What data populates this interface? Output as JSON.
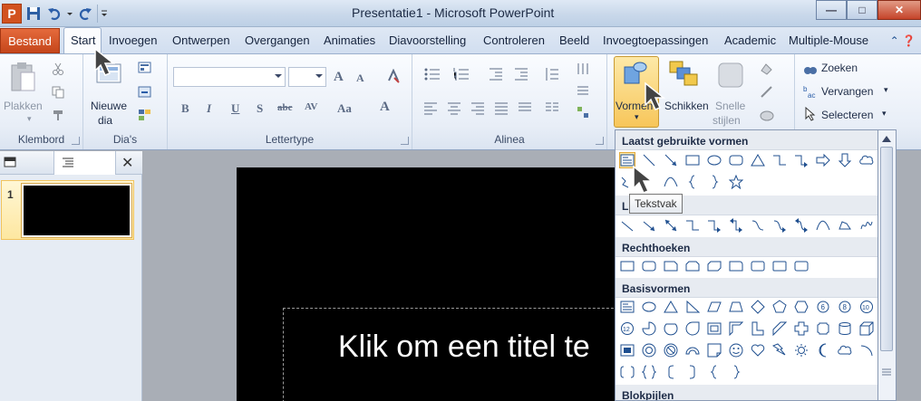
{
  "window": {
    "title": "Presentatie1 - Microsoft PowerPoint",
    "app_icon_letter": "P",
    "controls": [
      "minimize-icon",
      "maximize-icon",
      "close-icon"
    ]
  },
  "quick_access": [
    "save-icon",
    "undo-icon",
    "redo-icon",
    "customize-icon"
  ],
  "tabs": {
    "file": "Bestand",
    "items": [
      "Start",
      "Invoegen",
      "Ontwerpen",
      "Overgangen",
      "Animaties",
      "Diavoorstelling",
      "Controleren",
      "Beeld",
      "Invoegtoepassingen",
      "Academic",
      "Multiple-Mouse"
    ],
    "active": "Start"
  },
  "ribbon": {
    "klembord": {
      "label": "Klembord",
      "paste": "Plakken"
    },
    "dias": {
      "label": "Dia's",
      "new_slide_1": "Nieuwe",
      "new_slide_2": "dia"
    },
    "lettertype": {
      "label": "Lettertype",
      "buttons": [
        "B",
        "I",
        "U",
        "S",
        "abc",
        "AV",
        "Aa",
        "A"
      ],
      "grow": "A",
      "shrink": "A"
    },
    "alinea": {
      "label": "Alinea"
    },
    "tekenen": {
      "shapes": "Vormen",
      "arrange": "Schikken",
      "quick_styles_1": "Snelle",
      "quick_styles_2": "stijlen"
    },
    "bewerken": {
      "find": "Zoeken",
      "replace": "Vervangen",
      "select": "Selecteren"
    }
  },
  "slides_panel": {
    "slide_number": "1"
  },
  "slide": {
    "title_placeholder": "Klik om een titel te"
  },
  "shapes_gallery": {
    "sections": [
      "Laatst gebruikte vormen",
      "L",
      "Rechthoeken",
      "Basisvormen",
      "Blokpijlen"
    ],
    "tooltip": "Tekstvak",
    "number_glyphs": [
      "6",
      "8",
      "10",
      "12"
    ]
  },
  "colors": {
    "file_tab": "#d45220",
    "selection": "#fde9a8",
    "slide_bg": "#000000"
  }
}
